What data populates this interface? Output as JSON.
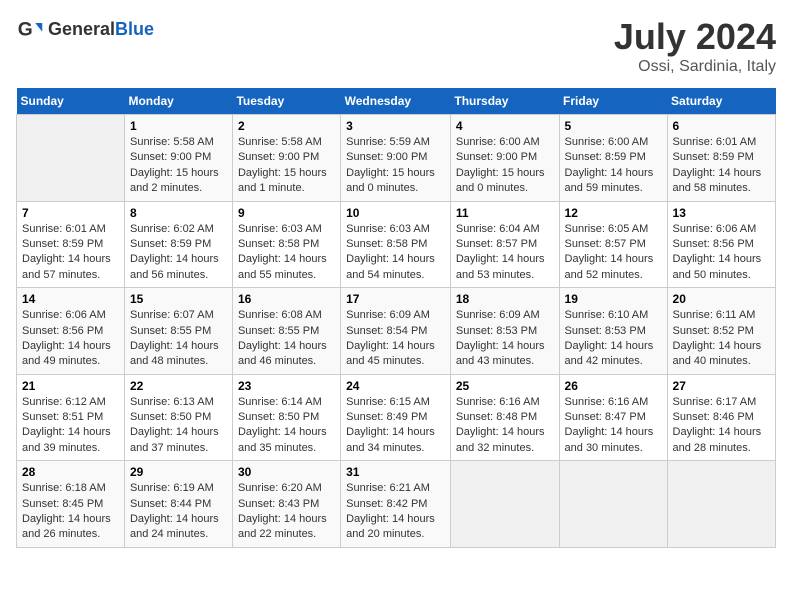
{
  "logo": {
    "general": "General",
    "blue": "Blue"
  },
  "title": "July 2024",
  "subtitle": "Ossi, Sardinia, Italy",
  "days_header": [
    "Sunday",
    "Monday",
    "Tuesday",
    "Wednesday",
    "Thursday",
    "Friday",
    "Saturday"
  ],
  "weeks": [
    [
      {
        "day": null
      },
      {
        "day": "1",
        "sunrise": "5:58 AM",
        "sunset": "9:00 PM",
        "daylight": "15 hours and 2 minutes."
      },
      {
        "day": "2",
        "sunrise": "5:58 AM",
        "sunset": "9:00 PM",
        "daylight": "15 hours and 1 minute."
      },
      {
        "day": "3",
        "sunrise": "5:59 AM",
        "sunset": "9:00 PM",
        "daylight": "15 hours and 0 minutes."
      },
      {
        "day": "4",
        "sunrise": "6:00 AM",
        "sunset": "9:00 PM",
        "daylight": "15 hours and 0 minutes."
      },
      {
        "day": "5",
        "sunrise": "6:00 AM",
        "sunset": "8:59 PM",
        "daylight": "14 hours and 59 minutes."
      },
      {
        "day": "6",
        "sunrise": "6:01 AM",
        "sunset": "8:59 PM",
        "daylight": "14 hours and 58 minutes."
      }
    ],
    [
      {
        "day": "7",
        "sunrise": "6:01 AM",
        "sunset": "8:59 PM",
        "daylight": "14 hours and 57 minutes."
      },
      {
        "day": "8",
        "sunrise": "6:02 AM",
        "sunset": "8:59 PM",
        "daylight": "14 hours and 56 minutes."
      },
      {
        "day": "9",
        "sunrise": "6:03 AM",
        "sunset": "8:58 PM",
        "daylight": "14 hours and 55 minutes."
      },
      {
        "day": "10",
        "sunrise": "6:03 AM",
        "sunset": "8:58 PM",
        "daylight": "14 hours and 54 minutes."
      },
      {
        "day": "11",
        "sunrise": "6:04 AM",
        "sunset": "8:57 PM",
        "daylight": "14 hours and 53 minutes."
      },
      {
        "day": "12",
        "sunrise": "6:05 AM",
        "sunset": "8:57 PM",
        "daylight": "14 hours and 52 minutes."
      },
      {
        "day": "13",
        "sunrise": "6:06 AM",
        "sunset": "8:56 PM",
        "daylight": "14 hours and 50 minutes."
      }
    ],
    [
      {
        "day": "14",
        "sunrise": "6:06 AM",
        "sunset": "8:56 PM",
        "daylight": "14 hours and 49 minutes."
      },
      {
        "day": "15",
        "sunrise": "6:07 AM",
        "sunset": "8:55 PM",
        "daylight": "14 hours and 48 minutes."
      },
      {
        "day": "16",
        "sunrise": "6:08 AM",
        "sunset": "8:55 PM",
        "daylight": "14 hours and 46 minutes."
      },
      {
        "day": "17",
        "sunrise": "6:09 AM",
        "sunset": "8:54 PM",
        "daylight": "14 hours and 45 minutes."
      },
      {
        "day": "18",
        "sunrise": "6:09 AM",
        "sunset": "8:53 PM",
        "daylight": "14 hours and 43 minutes."
      },
      {
        "day": "19",
        "sunrise": "6:10 AM",
        "sunset": "8:53 PM",
        "daylight": "14 hours and 42 minutes."
      },
      {
        "day": "20",
        "sunrise": "6:11 AM",
        "sunset": "8:52 PM",
        "daylight": "14 hours and 40 minutes."
      }
    ],
    [
      {
        "day": "21",
        "sunrise": "6:12 AM",
        "sunset": "8:51 PM",
        "daylight": "14 hours and 39 minutes."
      },
      {
        "day": "22",
        "sunrise": "6:13 AM",
        "sunset": "8:50 PM",
        "daylight": "14 hours and 37 minutes."
      },
      {
        "day": "23",
        "sunrise": "6:14 AM",
        "sunset": "8:50 PM",
        "daylight": "14 hours and 35 minutes."
      },
      {
        "day": "24",
        "sunrise": "6:15 AM",
        "sunset": "8:49 PM",
        "daylight": "14 hours and 34 minutes."
      },
      {
        "day": "25",
        "sunrise": "6:16 AM",
        "sunset": "8:48 PM",
        "daylight": "14 hours and 32 minutes."
      },
      {
        "day": "26",
        "sunrise": "6:16 AM",
        "sunset": "8:47 PM",
        "daylight": "14 hours and 30 minutes."
      },
      {
        "day": "27",
        "sunrise": "6:17 AM",
        "sunset": "8:46 PM",
        "daylight": "14 hours and 28 minutes."
      }
    ],
    [
      {
        "day": "28",
        "sunrise": "6:18 AM",
        "sunset": "8:45 PM",
        "daylight": "14 hours and 26 minutes."
      },
      {
        "day": "29",
        "sunrise": "6:19 AM",
        "sunset": "8:44 PM",
        "daylight": "14 hours and 24 minutes."
      },
      {
        "day": "30",
        "sunrise": "6:20 AM",
        "sunset": "8:43 PM",
        "daylight": "14 hours and 22 minutes."
      },
      {
        "day": "31",
        "sunrise": "6:21 AM",
        "sunset": "8:42 PM",
        "daylight": "14 hours and 20 minutes."
      },
      {
        "day": null
      },
      {
        "day": null
      },
      {
        "day": null
      }
    ]
  ]
}
